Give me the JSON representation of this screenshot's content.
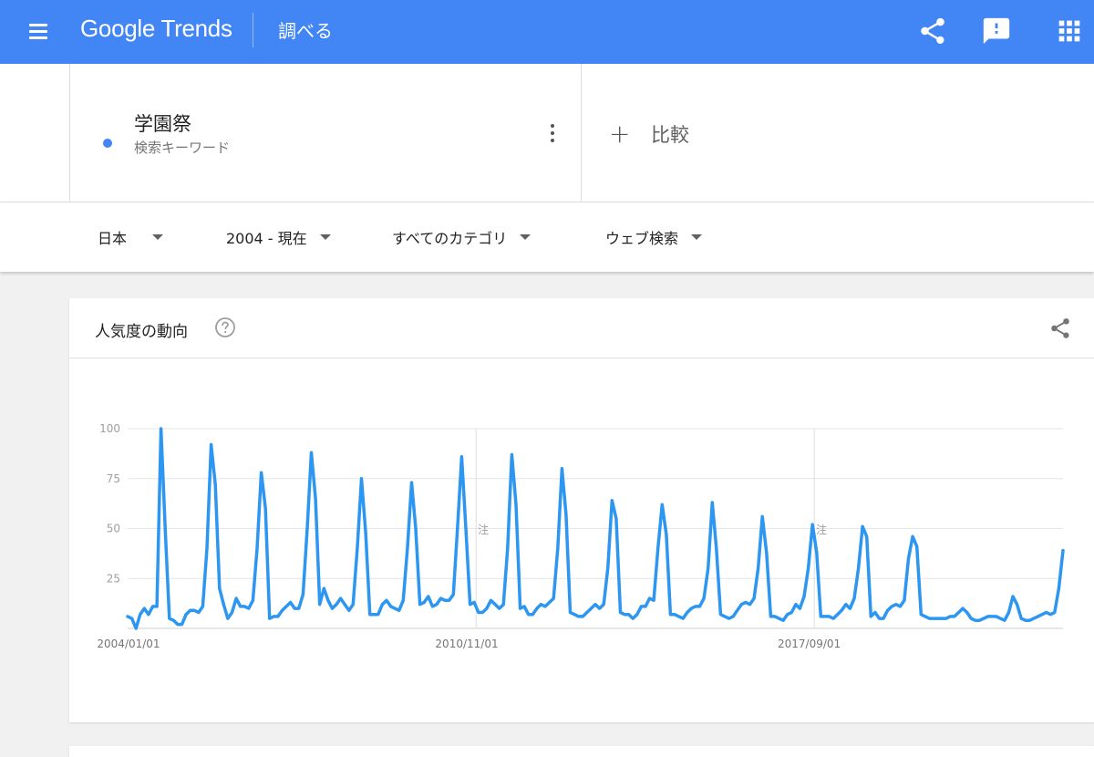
{
  "header": {
    "logo_google": "Google",
    "logo_trends": " Trends",
    "page_title": "調べる"
  },
  "search": {
    "term": "学園祭",
    "term_type": "検索キーワード",
    "term_color": "#4285f4",
    "compare_label": "比較"
  },
  "filters": {
    "region": "日本",
    "time_range": "2004 - 現在",
    "category": "すべてのカテゴリ",
    "search_type": "ウェブ検索"
  },
  "interest_card": {
    "title": "人気度の動向"
  },
  "chart_data": {
    "type": "line",
    "y_ticks": [
      "100",
      "75",
      "50",
      "25"
    ],
    "ylim": [
      0,
      100
    ],
    "x_labels": [
      "2004/01/01",
      "2010/11/01",
      "2017/09/01"
    ],
    "note_marker": "注",
    "line_color": "#2d96f0",
    "grid": true,
    "series": [
      {
        "values": [
          6,
          5,
          0,
          7,
          10,
          7,
          11,
          11,
          100,
          50,
          5,
          4,
          2,
          2,
          7,
          9,
          9,
          8,
          11,
          40,
          92,
          72,
          20,
          12,
          5,
          8,
          15,
          11,
          11,
          10,
          14,
          40,
          78,
          60,
          5,
          6,
          6,
          9,
          11,
          13,
          10,
          10,
          17,
          50,
          88,
          65,
          12,
          20,
          14,
          10,
          12,
          15,
          12,
          9,
          12,
          40,
          75,
          48,
          7,
          7,
          7,
          12,
          14,
          11,
          10,
          9,
          14,
          40,
          73,
          50,
          12,
          13,
          16,
          11,
          12,
          15,
          14,
          14,
          17,
          50,
          86,
          50,
          12,
          13,
          8,
          8,
          10,
          14,
          12,
          10,
          12,
          40,
          87,
          62,
          10,
          11,
          7,
          7,
          10,
          12,
          11,
          13,
          15,
          40,
          80,
          57,
          8,
          7,
          6,
          6,
          8,
          10,
          12,
          10,
          12,
          30,
          64,
          55,
          8,
          7,
          7,
          5,
          7,
          11,
          11,
          15,
          14,
          40,
          62,
          47,
          7,
          7,
          6,
          5,
          8,
          10,
          11,
          11,
          15,
          30,
          63,
          40,
          7,
          6,
          5,
          6,
          9,
          12,
          13,
          12,
          15,
          30,
          56,
          38,
          6,
          6,
          5,
          4,
          7,
          8,
          12,
          10,
          16,
          30,
          52,
          38,
          6,
          6,
          6,
          5,
          7,
          9,
          12,
          10,
          15,
          30,
          51,
          46,
          6,
          8,
          5,
          5,
          9,
          11,
          12,
          11,
          14,
          35,
          46,
          41,
          7,
          6,
          5,
          5,
          5,
          5,
          5,
          6,
          6,
          8,
          10,
          8,
          5,
          4,
          4,
          5,
          6,
          6,
          6,
          5,
          4,
          8,
          16,
          12,
          5,
          4,
          4,
          5,
          6,
          7,
          8,
          7,
          8,
          20,
          39
        ]
      }
    ]
  }
}
